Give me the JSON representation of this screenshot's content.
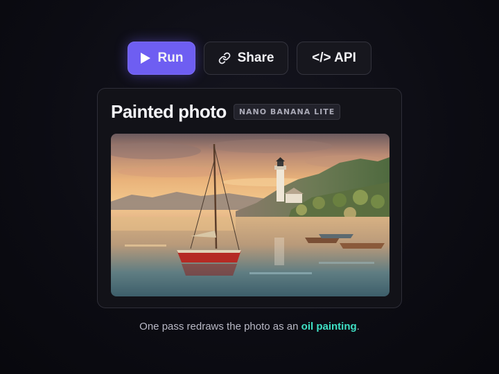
{
  "toolbar": {
    "run_label": "Run",
    "share_label": "Share",
    "api_label": "</> API",
    "accent_color": "#6e5ef2"
  },
  "icons": {
    "run": "play-icon",
    "share": "link-icon"
  },
  "card": {
    "title": "Painted photo",
    "badge": "NANO BANANA LITE",
    "image_subject": "oil painting of a red sailboat in a harbor at sunset with a lighthouse on a hill"
  },
  "caption": {
    "prefix": "One pass redraws the photo as an ",
    "highlight": "oil painting",
    "suffix": ".",
    "highlight_color": "#3fe0c5"
  }
}
